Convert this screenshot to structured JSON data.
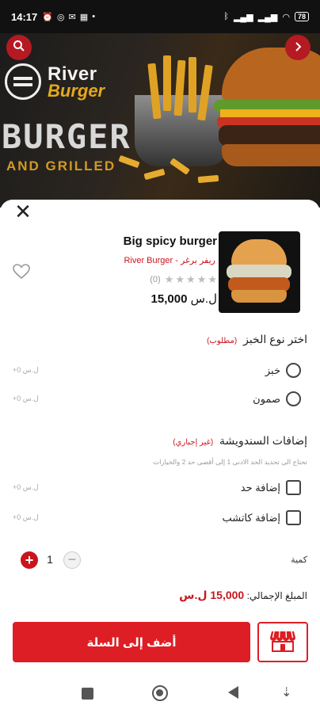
{
  "status_bar": {
    "time": "14:17",
    "battery": "78",
    "left_icons": [
      "alarm-icon",
      "whatsapp-icon",
      "message-icon",
      "grid-icon",
      "dot-icon"
    ],
    "right_icons": [
      "bluetooth-icon",
      "signal-icon",
      "signal-icon",
      "wifi-icon",
      "battery-icon"
    ]
  },
  "hero": {
    "brand_top": "River",
    "brand_bottom": "Burger",
    "headline": "BURGER",
    "subline": "AND GRILLED",
    "search_icon": "search-icon",
    "next_icon": "chevron-right-icon"
  },
  "product": {
    "title": "Big spicy burger",
    "vendor": "River Burger - ريفر برغر",
    "rating_count": "(0)",
    "rating_stars": 0,
    "price_value": "15,000",
    "currency": "ل.س"
  },
  "bread_section": {
    "title": "اختر نوع الخبز",
    "tag": "(مطلوب)",
    "options": [
      {
        "label": "خبز",
        "price": "+0 ل.س"
      },
      {
        "label": "صمون",
        "price": "+0 ل.س"
      }
    ]
  },
  "addons_section": {
    "title": "إضافات السندويشة",
    "tag": "(غير إجباري)",
    "hint": "تحتاج الى تحديد الحد الادنى 1 إلى أقصى حد 2 والخيارات",
    "options": [
      {
        "label": "إضافة حد",
        "price": "+0 ل.س"
      },
      {
        "label": "إضافة كاتشب",
        "price": "+0 ل.س"
      }
    ]
  },
  "quantity": {
    "label": "كمية",
    "value": "1"
  },
  "total": {
    "label": "المبلغ الإجمالي:",
    "amount": "15,000 ل.س"
  },
  "actions": {
    "add_to_cart": "أضف إلى السلة"
  }
}
